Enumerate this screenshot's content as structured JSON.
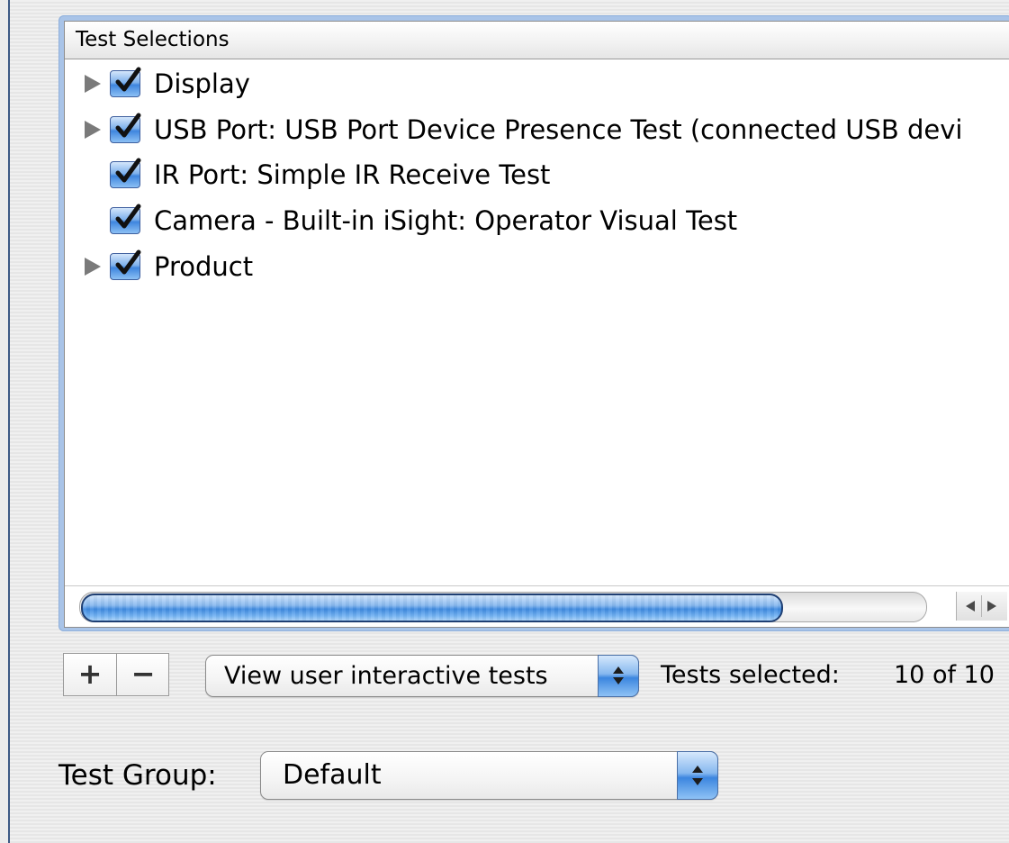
{
  "test_selections": {
    "header": "Test Selections",
    "rows": [
      {
        "label": "Display",
        "expandable": true,
        "checked": true
      },
      {
        "label": "USB Port: USB Port Device Presence Test (connected USB devi",
        "expandable": true,
        "checked": true
      },
      {
        "label": "IR Port: Simple IR Receive Test",
        "expandable": false,
        "checked": true
      },
      {
        "label": "Camera - Built-in iSight: Operator Visual Test",
        "expandable": false,
        "checked": true
      },
      {
        "label": "Product",
        "expandable": true,
        "checked": true
      }
    ]
  },
  "controls": {
    "add_label": "+",
    "remove_label": "−",
    "view_filter": {
      "selected": "View user interactive tests"
    },
    "tests_selected_label": "Tests selected:",
    "tests_selected_value": "10 of 10"
  },
  "test_group": {
    "label": "Test Group:",
    "selected": "Default"
  },
  "colors": {
    "accent_blue": "#3c86df",
    "window_edge": "#3d5a85"
  },
  "icons": [
    "disclosure-triangle-icon",
    "checkmark-icon",
    "scroll-left-arrow-icon",
    "scroll-right-arrow-icon",
    "popup-stepper-icon"
  ]
}
